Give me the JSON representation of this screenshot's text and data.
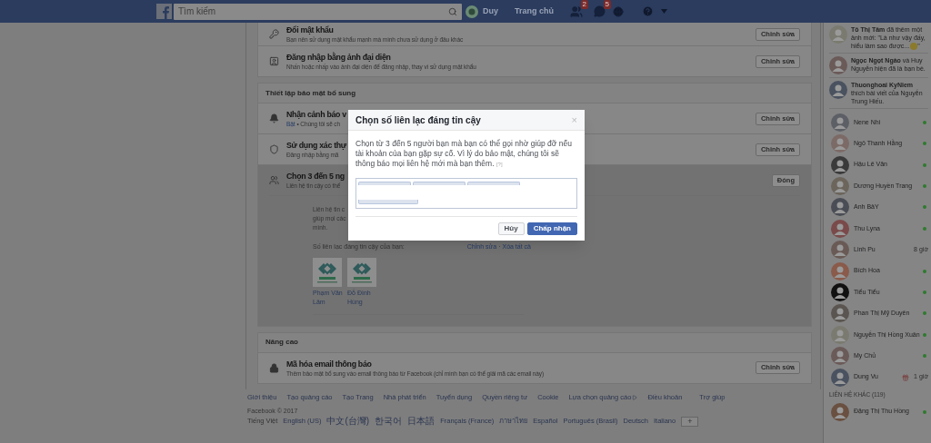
{
  "top_bar": {
    "search": {
      "placeholder": "Tìm kiếm"
    },
    "profile_name": "Duy",
    "home_link": "Trang chủ",
    "friend_requests_badge": "2",
    "messages_badge": "5"
  },
  "sections": [
    {
      "rows": [
        {
          "title": "Đổi mật khẩu",
          "subtitle": "Bạn nên sử dụng mật khẩu mạnh mà mình chưa sử dụng ở đâu khác",
          "button": "Chỉnh sửa",
          "expanded": false
        },
        {
          "title": "Đăng nhập bằng ảnh đại diện",
          "subtitle": "Nhấn hoặc nhấp vào ảnh đại diện để đăng nhập, thay vì sử dụng mật khẩu",
          "button": "Chỉnh sửa",
          "expanded": false
        }
      ]
    },
    {
      "header": "Thiết lập bảo mật bổ sung",
      "rows": [
        {
          "title": "Nhận cảnh báo v",
          "link": "Bật",
          "subtitle": "• Chúng tôi sẽ ch",
          "button": "Chỉnh sửa",
          "expanded": false
        },
        {
          "title": "Sử dụng xác thự",
          "subtitle": "Đăng nhập bằng mã",
          "button": "Chỉnh sửa",
          "expanded": false
        },
        {
          "title": "Chọn 3 đến 5 ng",
          "subtitle": "Liên hệ tin cậy có thể",
          "button": "Đóng",
          "expanded": true,
          "details": {
            "description_lines": [
              "Liên hệ tin c",
              "giúp mọi các",
              "mình."
            ],
            "contacts_label": "Số liên lạc đáng tin cậy của bạn:",
            "edit_link": "Chỉnh sửa",
            "separator": "·",
            "remove_all_link": "Xóa tất cả",
            "contacts": [
              {
                "name": "Phạm Văn Lâm"
              },
              {
                "name": "Đỗ Đình Hùng"
              }
            ]
          }
        }
      ]
    },
    {
      "header": "Nâng cao",
      "rows": [
        {
          "title": "Mã hóa email thông báo",
          "subtitle": "Thêm bảo mật bổ sung vào email thông báo từ Facebook (chỉ mình bạn có thể giải mã các email này)",
          "button": "Chỉnh sửa",
          "expanded": false
        }
      ]
    }
  ],
  "dialog": {
    "title": "Chọn số liên lạc đáng tin cậy",
    "close": "×",
    "body": "Chọn từ 3 đến 5 người bạn mà bạn có thể gọi nhờ giúp đỡ nếu tài khoản của bạn gặp sự cố. Vì lý do bảo mật, chúng tôi sẽ thông báo mọi liên hệ mới mà bạn thêm.",
    "help": "[?]",
    "selected_contacts": [
      {
        "kind": "redacted"
      },
      {
        "kind": "redacted"
      },
      {
        "kind": "redacted"
      },
      {
        "kind": "redacted"
      }
    ],
    "cancel": "Hủy",
    "confirm": "Chấp nhận"
  },
  "footer": {
    "links": [
      "Giới thiệu",
      "Tạo quảng cáo",
      "Tạo Trang",
      "Nhà phát triển",
      "Tuyển dụng",
      "Quyền riêng tư",
      "Cookie",
      "Lựa chọn quảng cáo",
      "Điều khoản",
      "Trợ giúp"
    ],
    "copyright": "Facebook © 2017",
    "languages": [
      {
        "label": "Tiếng Việt",
        "selected": true
      },
      {
        "label": "English (US)",
        "selected": false
      },
      {
        "label": "中文(台灣)",
        "selected": false
      },
      {
        "label": "한국어",
        "selected": false
      },
      {
        "label": "日本語",
        "selected": false
      },
      {
        "label": "Français (France)",
        "selected": false
      },
      {
        "label": "ภาษาไทย",
        "selected": false
      },
      {
        "label": "Español",
        "selected": false
      },
      {
        "label": "Português (Brasil)",
        "selected": false
      },
      {
        "label": "Deutsch",
        "selected": false
      },
      {
        "label": "Italiano",
        "selected": false
      }
    ],
    "more": "+"
  },
  "sidebar": {
    "activity": [
      {
        "text": "**Tô Thị Tâm** đã thêm một ảnh mới: \"Là như vậy đấy, hiểu làm sao được...",
        "emoji": true,
        "end": "\""
      },
      {
        "text": "**Ngọc Ngọt Ngào** và Huy Nguyễn hiện đã là bạn bè.",
        "emoji": false
      },
      {
        "text": "**Thuonghoai KyNiem** thích bài viết của Nguyễn Trung Hiếu.",
        "emoji": false
      }
    ],
    "contacts": [
      {
        "name": "Nene Nhi",
        "online": true
      },
      {
        "name": "Ngô Thanh Hằng",
        "online": true
      },
      {
        "name": "Hậu Lê Văn",
        "online": true
      },
      {
        "name": "Dương Huyền Trang",
        "online": true
      },
      {
        "name": "Anh BảY",
        "online": true
      },
      {
        "name": "Thu Lyna",
        "online": true
      },
      {
        "name": "Linh Pu",
        "online": false,
        "last_active": "8 giờ"
      },
      {
        "name": "Bích Hoa",
        "online": true
      },
      {
        "name": "Tiểu Tiểu",
        "online": true
      },
      {
        "name": "Phan Thị Mỹ Duyên",
        "online": true
      },
      {
        "name": "Nguyễn Thị Hồng Xuân",
        "online": true
      },
      {
        "name": "My Chủ",
        "online": true
      },
      {
        "name": "Dung Vu",
        "online": false,
        "birthday": true,
        "last_active": "1 giờ"
      }
    ],
    "other_contacts_header": "LIÊN HỆ KHÁC (119)",
    "other_contacts": [
      {
        "name": "Đặng Thị Thu Hồng",
        "online": true
      }
    ]
  }
}
